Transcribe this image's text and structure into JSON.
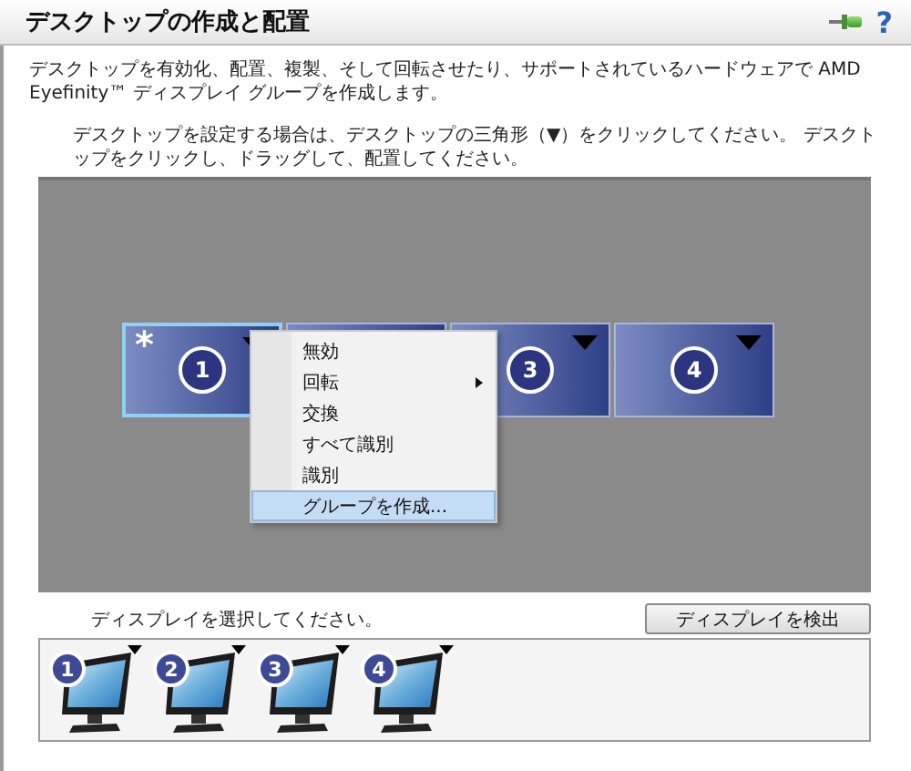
{
  "header": {
    "title": "デスクトップの作成と配置",
    "help": "?"
  },
  "description": "デスクトップを有効化、配置、複製、そして回転させたり、サポートされているハードウェアで AMD Eyefinity™ ディスプレイ グループを作成します。",
  "instruction": "デスクトップを設定する場合は、デスクトップの三角形（▼）をクリックしてください。 デスクトップをクリックし、ドラッグして、配置してください。",
  "desktops": [
    {
      "number": "1",
      "selected": true,
      "primary": "*",
      "dropdown": true
    },
    {
      "selected": false
    },
    {
      "number": "3",
      "selected": false,
      "dropdown": true
    },
    {
      "number": "4",
      "selected": false,
      "dropdown": true
    }
  ],
  "context_menu": {
    "items": [
      {
        "label": "無効",
        "kind": "plain",
        "selected": false
      },
      {
        "label": "回転",
        "kind": "submenu",
        "selected": false
      },
      {
        "label": "交換",
        "kind": "plain",
        "selected": false
      },
      {
        "label": "すべて識別",
        "kind": "plain",
        "selected": false
      },
      {
        "label": "識別",
        "kind": "plain",
        "selected": false
      },
      {
        "label": "グループを作成...",
        "kind": "plain",
        "selected": true
      }
    ]
  },
  "select_prompt": "ディスプレイを選択してください。",
  "detect_button": "ディスプレイを検出",
  "displays": [
    {
      "number": "1"
    },
    {
      "number": "2"
    },
    {
      "number": "3"
    },
    {
      "number": "4"
    }
  ]
}
